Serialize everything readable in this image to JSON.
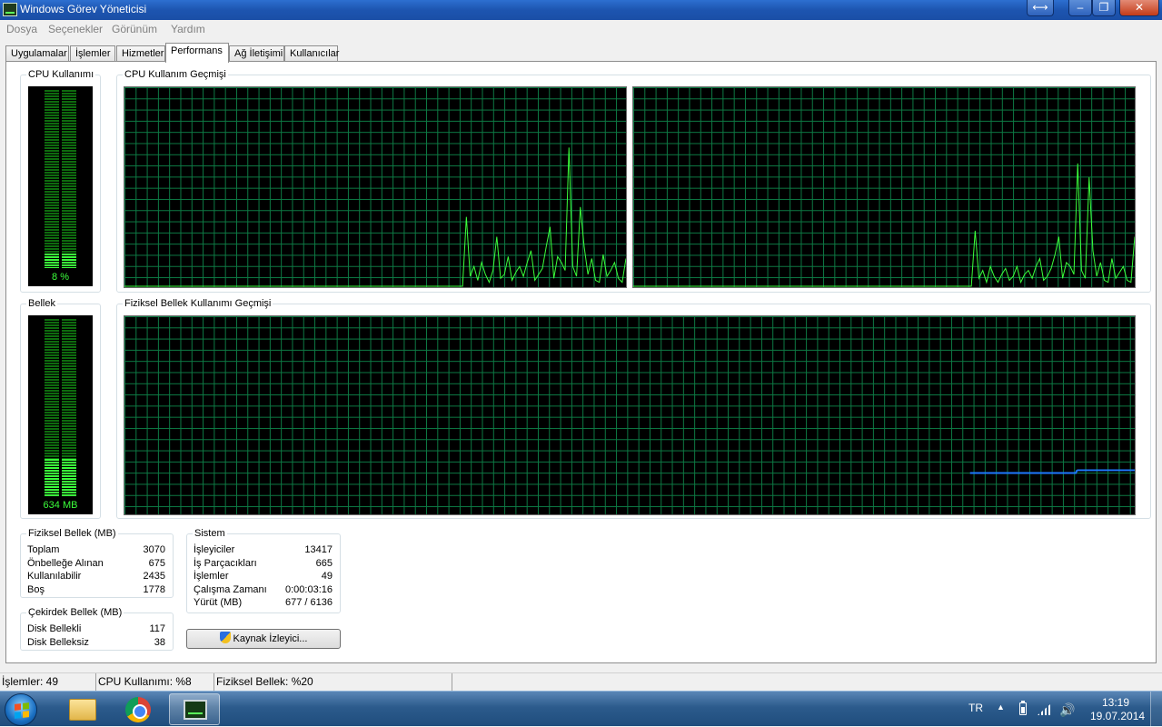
{
  "window": {
    "title": "Windows Görev Yöneticisi",
    "controls": {
      "restore_arrows": "⟷",
      "minimize": "–",
      "maximize": "❐",
      "close": "✕"
    }
  },
  "menu": [
    "Dosya",
    "Seçenekler",
    "Görünüm",
    "Yardım"
  ],
  "tabs": [
    "Uygulamalar",
    "İşlemler",
    "Hizmetler",
    "Performans",
    "Ağ İletişimi",
    "Kullanıcılar"
  ],
  "active_tab": "Performans",
  "cpu": {
    "label": "CPU Kullanımı",
    "meter_text": "8 %",
    "meter_level": 0.08,
    "history_label": "CPU Kullanım Geçmişi",
    "core1": [
      0,
      0,
      0,
      0,
      0,
      0,
      0,
      0,
      0,
      0,
      0,
      0,
      0,
      0,
      0,
      0,
      0,
      0,
      0,
      0,
      0,
      0,
      0,
      0,
      0,
      0,
      0,
      0,
      0,
      0,
      0,
      0,
      0,
      0,
      0,
      0,
      0,
      0,
      0,
      0,
      0,
      0,
      0,
      0,
      0,
      0,
      0,
      0,
      0,
      0,
      0,
      0,
      0,
      0,
      0,
      0,
      0,
      0,
      0,
      0,
      0,
      0,
      0,
      0,
      0,
      0,
      0,
      0,
      0,
      0,
      0,
      0,
      0,
      0,
      0,
      0,
      0,
      0,
      0,
      0,
      0,
      0,
      0,
      0,
      0,
      0,
      0,
      0,
      0,
      0,
      35,
      5,
      10,
      3,
      12,
      6,
      2,
      8,
      25,
      4,
      6,
      15,
      3,
      7,
      10,
      5,
      12,
      18,
      3,
      6,
      9,
      20,
      30,
      4,
      15,
      12,
      8,
      70,
      10,
      5,
      40,
      20,
      6,
      14,
      3,
      2,
      16,
      5,
      8,
      12,
      4,
      2,
      14
    ],
    "core2": [
      0,
      0,
      0,
      0,
      0,
      0,
      0,
      0,
      0,
      0,
      0,
      0,
      0,
      0,
      0,
      0,
      0,
      0,
      0,
      0,
      0,
      0,
      0,
      0,
      0,
      0,
      0,
      0,
      0,
      0,
      0,
      0,
      0,
      0,
      0,
      0,
      0,
      0,
      0,
      0,
      0,
      0,
      0,
      0,
      0,
      0,
      0,
      0,
      0,
      0,
      0,
      0,
      0,
      0,
      0,
      0,
      0,
      0,
      0,
      0,
      0,
      0,
      0,
      0,
      0,
      0,
      0,
      0,
      0,
      0,
      0,
      0,
      0,
      0,
      0,
      0,
      0,
      0,
      0,
      0,
      0,
      0,
      0,
      0,
      0,
      0,
      0,
      0,
      0,
      0,
      28,
      4,
      8,
      2,
      10,
      5,
      2,
      6,
      9,
      3,
      5,
      10,
      2,
      6,
      8,
      4,
      10,
      14,
      3,
      5,
      9,
      16,
      25,
      4,
      12,
      10,
      6,
      62,
      8,
      4,
      55,
      18,
      5,
      12,
      3,
      2,
      14,
      4,
      7,
      10,
      3,
      2,
      25
    ]
  },
  "memory": {
    "label": "Bellek",
    "meter_text": "634 MB",
    "meter_level": 0.21,
    "history_label": "Fiziksel Bellek Kullanımı Geçmişi",
    "history_start": 0.837,
    "history": [
      20.6,
      20.6,
      20.6,
      20.6,
      20.6,
      20.6,
      20.6,
      20.6,
      20.6,
      20.6,
      20.6,
      20.6,
      20.6,
      20.6,
      20.6,
      20.6,
      20.6,
      20.6,
      20.6,
      20.6,
      20.6,
      20.6,
      20.6,
      20.6,
      20.6,
      20.6,
      20.6,
      20.6,
      20.6,
      20.6,
      20.6,
      20.6,
      20.6,
      20.6,
      20.6,
      20.6,
      20.6,
      20.6,
      20.6,
      20.6,
      20.6,
      20.6,
      20.6,
      20.6,
      20.6,
      20.6,
      20.6,
      20.6,
      20.6,
      20.6,
      20.6,
      20.6,
      20.6,
      20.6,
      20.6,
      20.6,
      20.6,
      20.6,
      20.6,
      20.6,
      20.6,
      20.6,
      20.6,
      20.6,
      20.6,
      20.6,
      20.6,
      20.6,
      20.6,
      20.6,
      20.6,
      20.6,
      20.6,
      20.6,
      20.6,
      20.6,
      20.6,
      20.6,
      20.6,
      20.6,
      20.6,
      20.6,
      20.6,
      20.6,
      20.6,
      20.6,
      20.6,
      20.6,
      20.6,
      20.6,
      20.6,
      20.6,
      20.6,
      20.6,
      20.6,
      20.6,
      20.6,
      20.6,
      20.6,
      20.6,
      20.6,
      20.6,
      20.6,
      20.6,
      20.6,
      20.6,
      20.6,
      20.6,
      20.6,
      20.6,
      20.6,
      20.6,
      20.6,
      20.6,
      20.6,
      20.6,
      21.8,
      22.0,
      22.0,
      22.0,
      22.0,
      22.0,
      22.0,
      22.0,
      22.0,
      22.0,
      22.0,
      22.0,
      22.0,
      22.0,
      22.0,
      22.0,
      22.0,
      22.0,
      22.0,
      22.0,
      22.0,
      22.0,
      22.0,
      22.0,
      22.0,
      22.0,
      22.0,
      22.0,
      22.0,
      22.0,
      22.0,
      22.0,
      22.0,
      22.0,
      22.0,
      22.0,
      22.0,
      22.0,
      22.0,
      22.0,
      22.0,
      22.0,
      22.0,
      22.0,
      22.0,
      22.0,
      22.0,
      22.0,
      22.0,
      22.0,
      22.0,
      22.0,
      22.0,
      22.0,
      22.0,
      22.0,
      22.0,
      22.0,
      22.0,
      22.0,
      22.0,
      22.0,
      22.0,
      22.0
    ]
  },
  "physical_memory": {
    "label": "Fiziksel Bellek (MB)",
    "rows": [
      {
        "k": "Toplam",
        "v": "3070"
      },
      {
        "k": "Önbelleğe Alınan",
        "v": "675"
      },
      {
        "k": "Kullanılabilir",
        "v": "2435"
      },
      {
        "k": "Boş",
        "v": "1778"
      }
    ]
  },
  "kernel_memory": {
    "label": "Çekirdek Bellek (MB)",
    "rows": [
      {
        "k": "Disk Bellekli",
        "v": "117"
      },
      {
        "k": "Disk Belleksiz",
        "v": "38"
      }
    ]
  },
  "system": {
    "label": "Sistem",
    "rows": [
      {
        "k": "İşleyiciler",
        "v": "13417"
      },
      {
        "k": "İş Parçacıkları",
        "v": "665"
      },
      {
        "k": "İşlemler",
        "v": "49"
      },
      {
        "k": "Çalışma Zamanı",
        "v": "0:00:03:16"
      },
      {
        "k": "Yürüt (MB)",
        "v": "677 / 6136"
      }
    ]
  },
  "resource_button": "Kaynak İzleyici...",
  "status": {
    "processes": "İşlemler: 49",
    "cpu": "CPU Kullanımı: %8",
    "memory": "Fiziksel Bellek: %20"
  },
  "taskbar": {
    "lang": "TR",
    "tray_arrow": "▲",
    "volume": "🔊",
    "time": "13:19",
    "date": "19.07.2014"
  },
  "colors": {
    "graph_line": "#3bff3b",
    "memory_line": "#1e78ff",
    "grid": "#0d7a44",
    "titlebar": "#1d55b0"
  }
}
